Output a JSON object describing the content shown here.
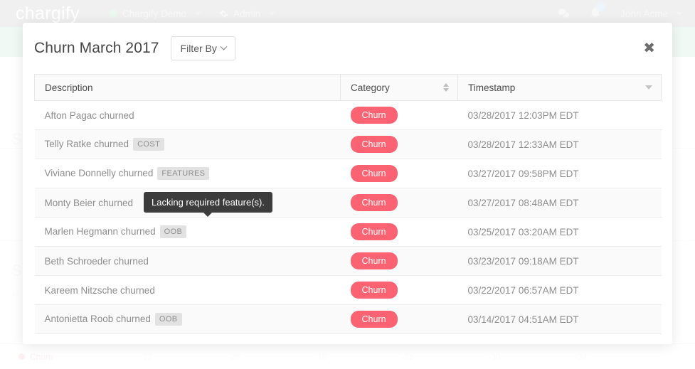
{
  "topbar": {
    "logo": "chargify",
    "nav": [
      {
        "label": "Chargify Demo",
        "icon": "status-dot-icon"
      },
      {
        "label": "Admin",
        "icon": "gear-icon"
      }
    ],
    "chat_icon": "chat-bubble-icon",
    "bell_icon": "bell-icon",
    "username": "John Acme"
  },
  "modal": {
    "title": "Churn March 2017",
    "filter_label": "Filter By",
    "close_label": "✖",
    "columns": [
      {
        "key": "description",
        "label": "Description",
        "sort": "none"
      },
      {
        "key": "category",
        "label": "Category",
        "sort": "both"
      },
      {
        "key": "timestamp",
        "label": "Timestamp",
        "sort": "desc"
      }
    ],
    "rows": [
      {
        "description": "Afton Pagac churned",
        "tag": "",
        "category": "Churn",
        "timestamp": "03/28/2017 12:03PM EDT"
      },
      {
        "description": "Telly Ratke churned",
        "tag": "COST",
        "category": "Churn",
        "timestamp": "03/28/2017 12:33AM EDT"
      },
      {
        "description": "Viviane Donnelly churned",
        "tag": "FEATURES",
        "category": "Churn",
        "timestamp": "03/27/2017 09:58PM EDT"
      },
      {
        "description": "Monty Beier churned",
        "tag": "",
        "category": "Churn",
        "timestamp": "03/27/2017 08:48AM EDT"
      },
      {
        "description": "Marlen Hegmann churned",
        "tag": "OOB",
        "category": "Churn",
        "timestamp": "03/25/2017 03:20AM EDT"
      },
      {
        "description": "Beth Schroeder churned",
        "tag": "",
        "category": "Churn",
        "timestamp": "03/23/2017 09:18AM EDT"
      },
      {
        "description": "Kareem Nitzsche churned",
        "tag": "",
        "category": "Churn",
        "timestamp": "03/22/2017 06:57AM EDT"
      },
      {
        "description": "Antonietta Roob churned",
        "tag": "OOB",
        "category": "Churn",
        "timestamp": "03/14/2017 04:51AM EDT"
      }
    ],
    "tooltip": "Lacking required feature(s)."
  },
  "background": {
    "headings": [
      "S",
      "S"
    ],
    "small_text": "14",
    "legend": {
      "label": "Churn",
      "values": [
        "13",
        "-25",
        "-18",
        "-25",
        "-30",
        "-34"
      ]
    }
  },
  "colors": {
    "churn_pill": "#fb6373",
    "topbar": "#d8d8d8",
    "band_green": "#d7efe2",
    "tooltip_bg": "#3c3c3c",
    "tag_bg": "#e2e2e2"
  }
}
